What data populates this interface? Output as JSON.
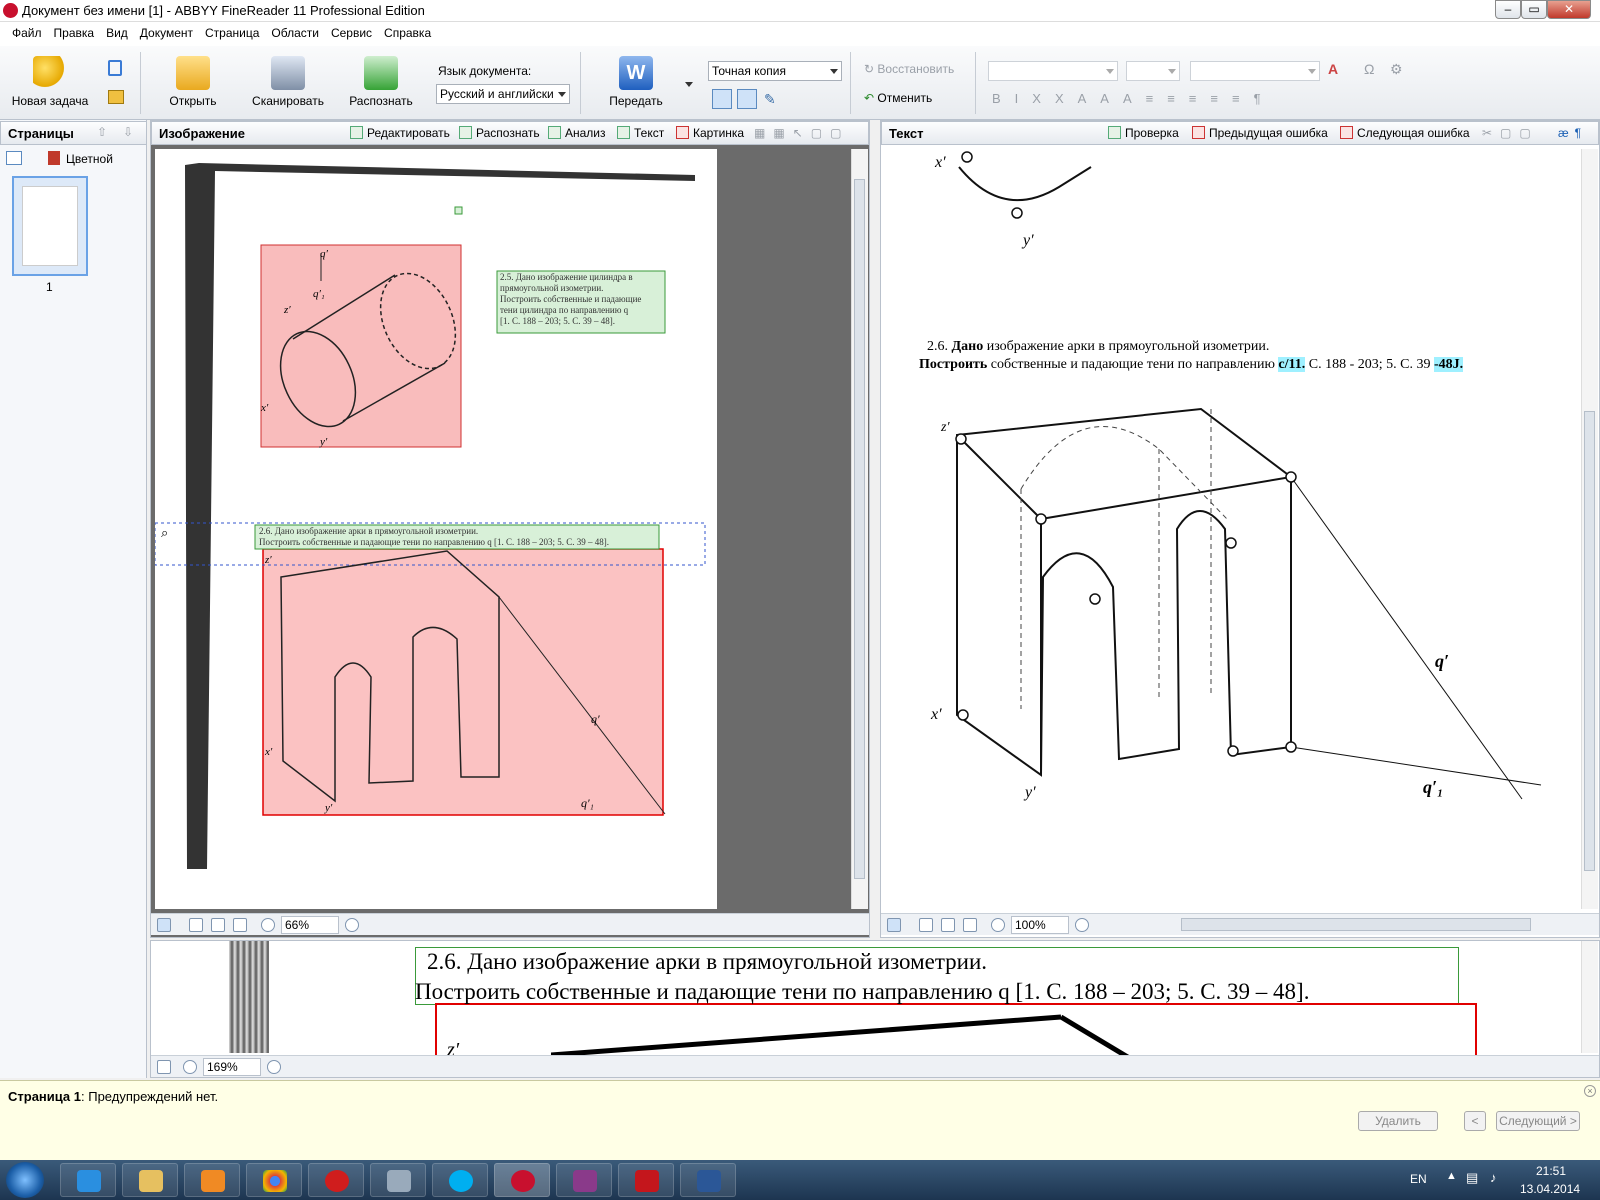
{
  "window": {
    "title": "Документ без имени [1] - ABBYY FineReader 11 Professional Edition"
  },
  "menu": [
    "Файл",
    "Правка",
    "Вид",
    "Документ",
    "Страница",
    "Области",
    "Сервис",
    "Справка"
  ],
  "ribbon": {
    "new_task": "Новая задача",
    "open": "Открыть",
    "scan": "Сканировать",
    "recognize": "Распознать",
    "doc_lang_label": "Язык документа:",
    "doc_lang_value": "Русский и английски",
    "send": "Передать",
    "format_value": "Точная копия",
    "restore": "Восстановить",
    "undo": "Отменить"
  },
  "pages_panel": {
    "title": "Страницы",
    "mode": "Цветной",
    "page_number": "1"
  },
  "image_panel": {
    "title": "Изображение",
    "tools": [
      "Редактировать",
      "Распознать",
      "Анализ",
      "Текст",
      "Картинка"
    ],
    "zoom": "66%"
  },
  "scan_page": {
    "block_25": [
      "2.5. Дано  изображение цилиндра  в",
      "прямоугольной изометрии.",
      "Построить собственные и падающие",
      "тени цилиндра по  направлению q",
      "[1. С. 188 – 203; 5. С. 39 – 48]."
    ],
    "block_26": [
      "2.6. Дано  изображение арки в прямоугольной изометрии.",
      "Построить собственные и падающие тени по направлению q [1. С. 188 – 203; 5. С. 39 – 48]."
    ],
    "labels": {
      "q": "q′",
      "q1": "q′₁",
      "z": "z′",
      "x": "x′",
      "y": "y′"
    }
  },
  "text_panel": {
    "title": "Текст",
    "check": "Проверка",
    "prev_error": "Предыдущая ошибка",
    "next_error": "Следующая ошибка",
    "zoom": "100%",
    "line1": {
      "a": "2.6. ",
      "b": "Дано",
      "c": " изображение арки в прямоугольной изометрии."
    },
    "line2": {
      "a": "Построить",
      "b": " собственные и падающие тени по направлению ",
      "c": "с/11.",
      "d": " С. 188 - 203; 5. С. 39 ",
      "e": "-48J."
    },
    "labels": {
      "q": "q′",
      "q1": "q′₁",
      "z": "z′",
      "x": "x′",
      "y": "y′"
    }
  },
  "zoom_panel": {
    "zoom": "169%",
    "line1": "2.6. Дано  изображение арки в прямоугольной изометрии.",
    "line2": "Построить собственные и падающие тени по направлению q [1. С. 188 – 203; 5. С. 39 – 48].",
    "z": "z′"
  },
  "status": {
    "page": "Страница 1",
    "message": ": Предупреждений нет.",
    "delete": "Удалить",
    "prev": "<",
    "next": "Следующий >"
  },
  "taskbar": {
    "lang": "EN",
    "time": "21:51",
    "date": "13.04.2014"
  }
}
